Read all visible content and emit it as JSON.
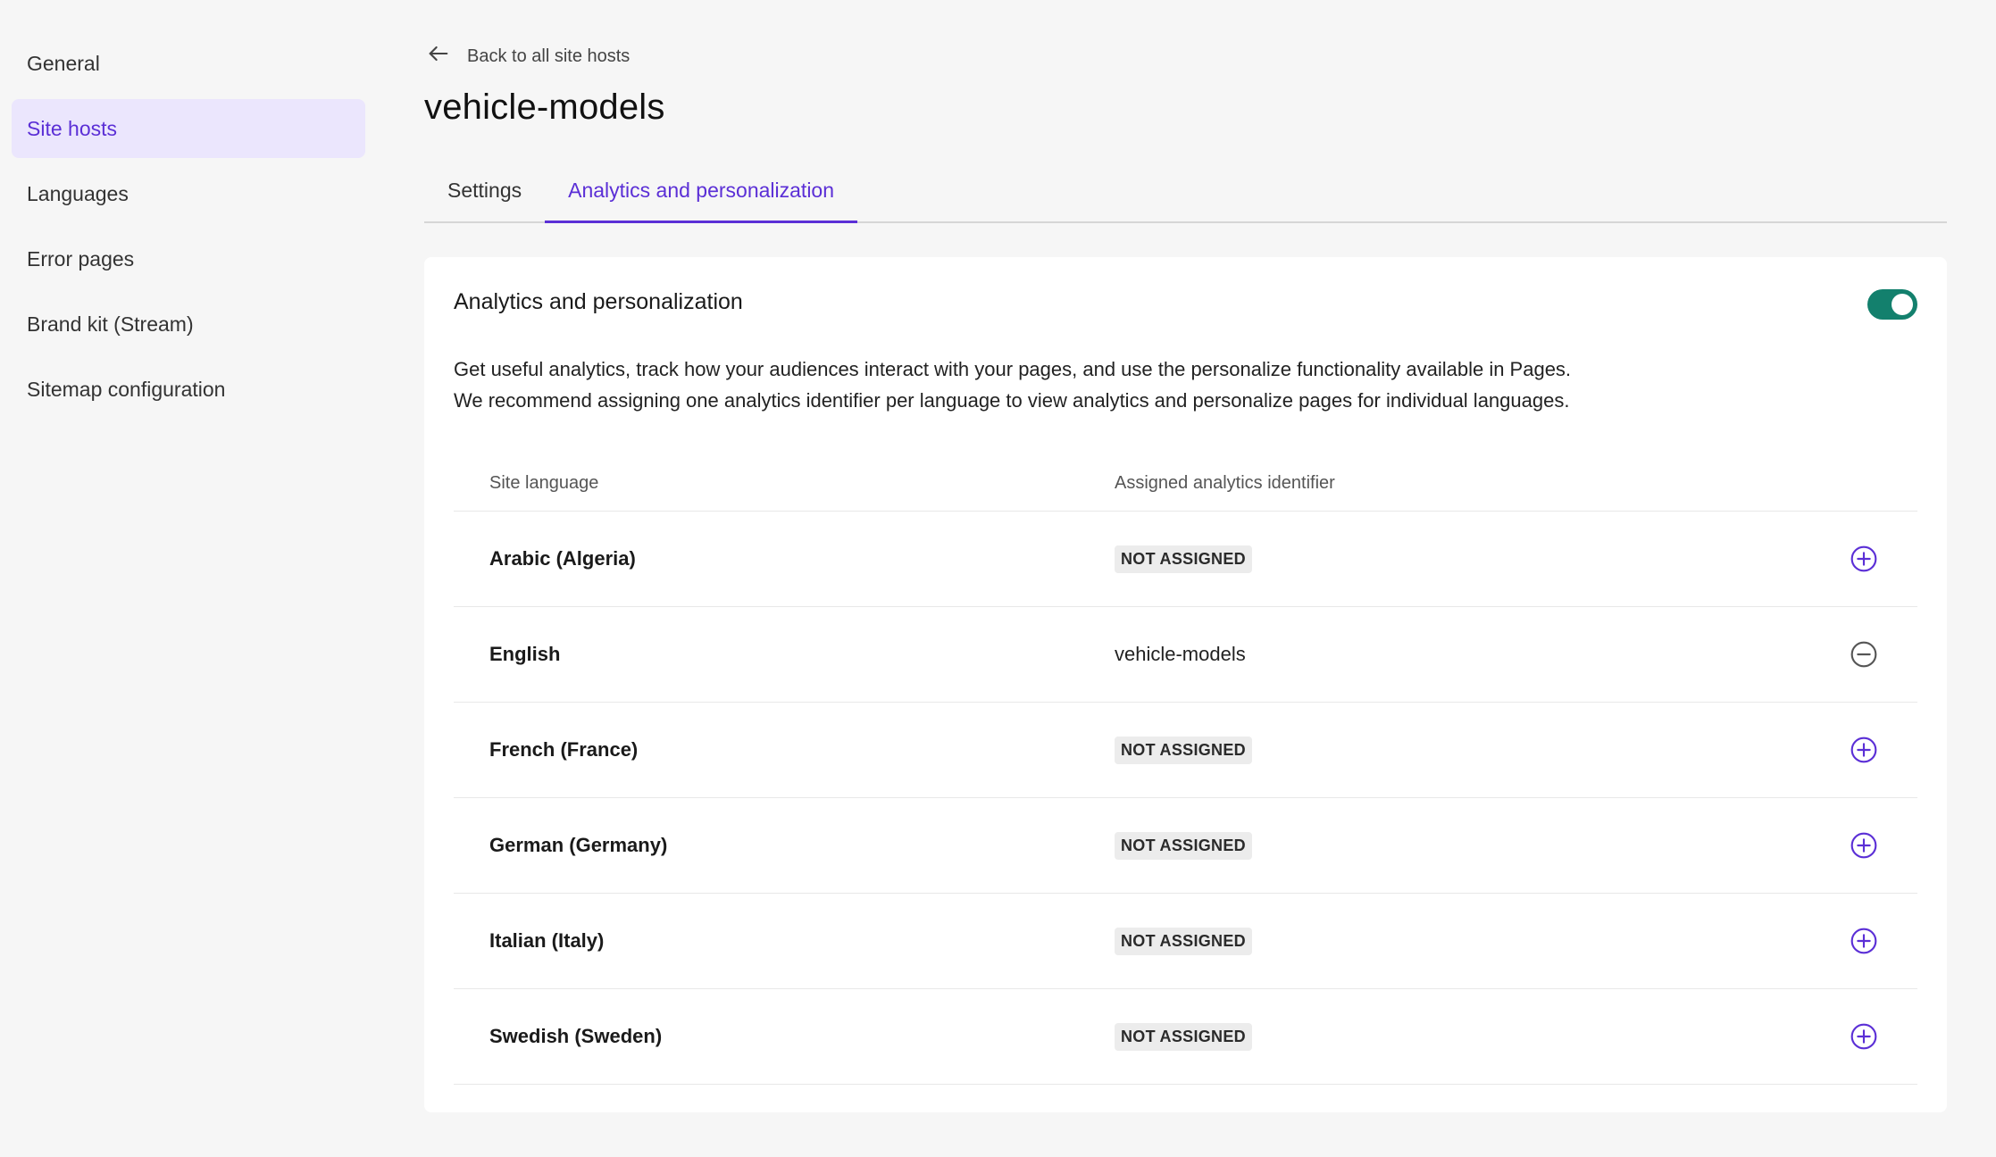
{
  "sidebar": {
    "items": [
      {
        "label": "General",
        "active": false
      },
      {
        "label": "Site hosts",
        "active": true
      },
      {
        "label": "Languages",
        "active": false
      },
      {
        "label": "Error pages",
        "active": false
      },
      {
        "label": "Brand kit (Stream)",
        "active": false
      },
      {
        "label": "Sitemap configuration",
        "active": false
      }
    ]
  },
  "header": {
    "back_label": "Back to all site hosts",
    "back_icon": "arrow-left-icon",
    "title": "vehicle-models"
  },
  "tabs": [
    {
      "label": "Settings",
      "active": false
    },
    {
      "label": "Analytics and personalization",
      "active": true
    }
  ],
  "card": {
    "title": "Analytics and personalization",
    "toggle_on": true,
    "description_line1": "Get useful analytics, track how your audiences interact with your pages, and use the personalize functionality available in Pages.",
    "description_line2": "We recommend assigning one analytics identifier per language to view analytics and personalize pages for individual languages."
  },
  "table": {
    "headers": {
      "language": "Site language",
      "identifier": "Assigned analytics identifier"
    },
    "rows": [
      {
        "language": "Arabic (Algeria)",
        "identifier": "NOT ASSIGNED",
        "assigned": false,
        "action_icon": "plus-circle-icon"
      },
      {
        "language": "English",
        "identifier": "vehicle-models",
        "assigned": true,
        "action_icon": "minus-circle-icon"
      },
      {
        "language": "French (France)",
        "identifier": "NOT ASSIGNED",
        "assigned": false,
        "action_icon": "plus-circle-icon"
      },
      {
        "language": "German (Germany)",
        "identifier": "NOT ASSIGNED",
        "assigned": false,
        "action_icon": "plus-circle-icon"
      },
      {
        "language": "Italian (Italy)",
        "identifier": "NOT ASSIGNED",
        "assigned": false,
        "action_icon": "plus-circle-icon"
      },
      {
        "language": "Swedish (Sweden)",
        "identifier": "NOT ASSIGNED",
        "assigned": false,
        "action_icon": "plus-circle-icon"
      }
    ]
  },
  "colors": {
    "accent": "#5b2fd6",
    "active_nav_bg": "#ebe6fd",
    "toggle_on": "#13806d",
    "remove_icon": "#555555",
    "page_bg": "#f6f6f6"
  }
}
